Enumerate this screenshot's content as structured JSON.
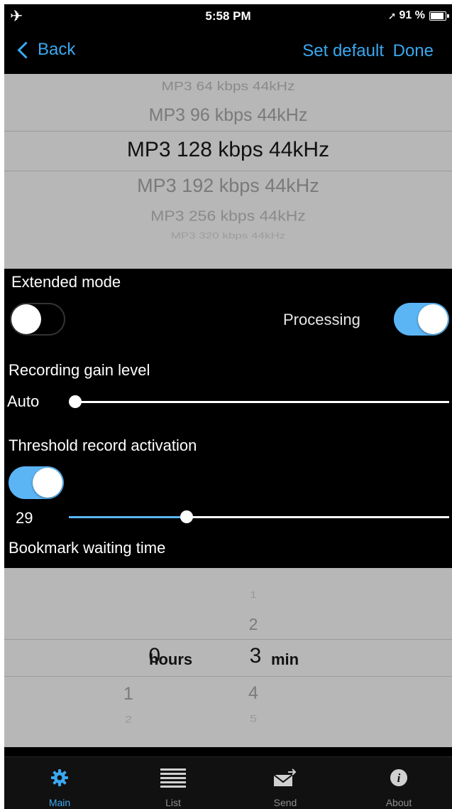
{
  "status": {
    "time": "5:58 PM",
    "battery": "91 %"
  },
  "nav": {
    "back": "Back",
    "set_default": "Set default",
    "done": "Done"
  },
  "format_picker": {
    "items": [
      "MP3 64 kbps 44kHz",
      "MP3 96 kbps 44kHz",
      "MP3 128 kbps 44kHz",
      "MP3 192 kbps 44kHz",
      "MP3 256 kbps 44kHz",
      "MP3 320 kbps 44kHz"
    ],
    "selected_index": 2
  },
  "extended_mode": {
    "label": "Extended mode",
    "on": false
  },
  "processing": {
    "label": "Processing",
    "on": true
  },
  "gain": {
    "label": "Recording gain level",
    "value_label": "Auto",
    "level": 0
  },
  "threshold": {
    "label": "Threshold record activation",
    "on": true,
    "value": "29",
    "level_fraction": 0.31
  },
  "bookmark": {
    "label": "Bookmark waiting time"
  },
  "time_picker": {
    "hours": {
      "above": [],
      "selected": "0",
      "below": [
        "1",
        "2"
      ],
      "unit": "hours"
    },
    "minutes": {
      "above": [
        "1",
        "2"
      ],
      "selected": "3",
      "below": [
        "4",
        "5"
      ],
      "unit": "min"
    }
  },
  "tabs": [
    {
      "label": "Main",
      "icon": "gear-icon",
      "active": true
    },
    {
      "label": "List",
      "icon": "list-icon",
      "active": false
    },
    {
      "label": "Send",
      "icon": "send-icon",
      "active": false
    },
    {
      "label": "About",
      "icon": "info-icon",
      "active": false
    }
  ],
  "colors": {
    "accent": "#3aa8f0",
    "toggle_on": "#5bb5f5",
    "picker_bg": "#b7b7b7"
  }
}
